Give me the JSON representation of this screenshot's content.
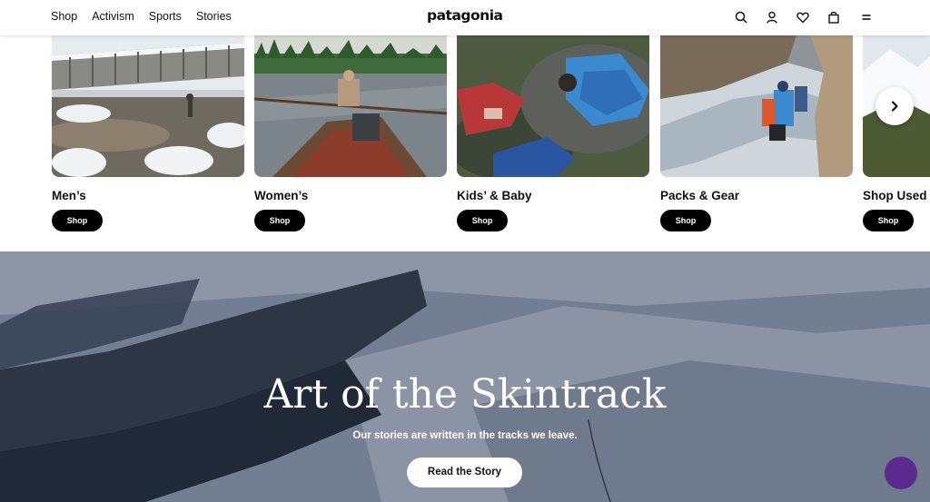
{
  "header": {
    "nav": [
      "Shop",
      "Activism",
      "Sports",
      "Stories"
    ],
    "logo": "patagonia",
    "icons": [
      "search-icon",
      "account-icon",
      "heart-icon",
      "bag-icon",
      "menu-icon"
    ]
  },
  "categories": [
    {
      "label": "Men’s",
      "button": "Shop"
    },
    {
      "label": "Women’s",
      "button": "Shop"
    },
    {
      "label": "Kids’ & Baby",
      "button": "Shop"
    },
    {
      "label": "Packs & Gear",
      "button": "Shop"
    },
    {
      "label": "Shop Used",
      "button": "Shop"
    }
  ],
  "hero": {
    "title": "Art of the Skintrack",
    "subtitle": "Our stories are written in the tracks we leave.",
    "button": "Read the Story"
  },
  "colors": {
    "chat_button": "#5b2a8f",
    "hero_snow": "#6a7587"
  }
}
